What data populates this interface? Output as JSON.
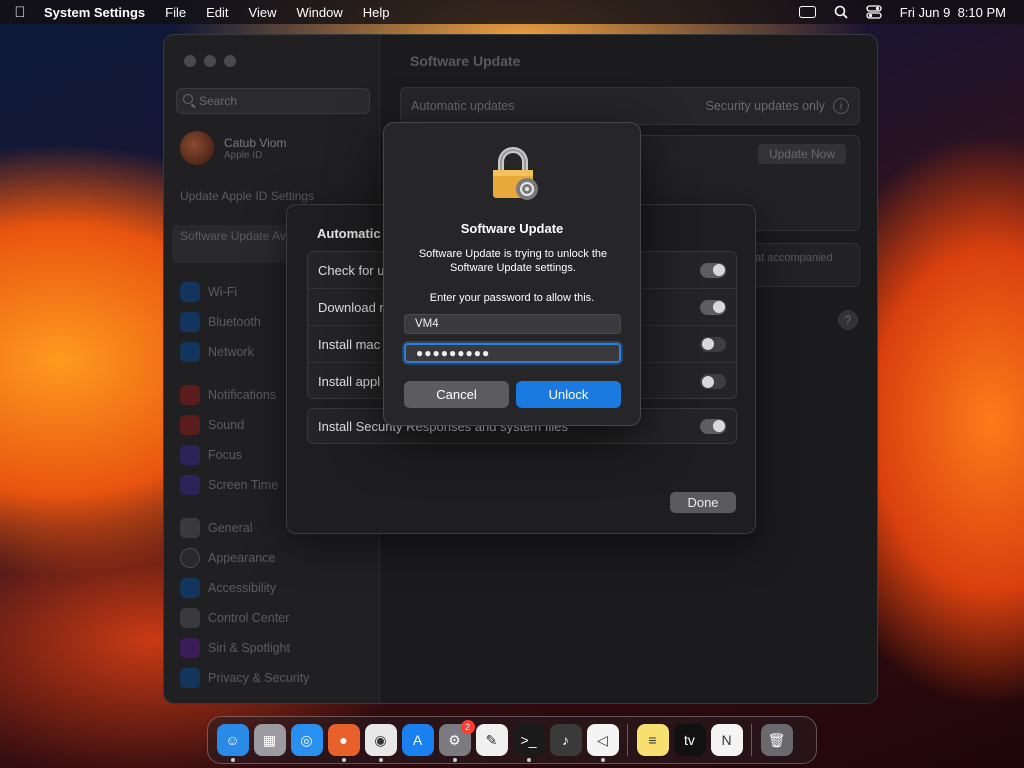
{
  "menubar": {
    "app_name": "System Settings",
    "menus": [
      "File",
      "Edit",
      "View",
      "Window",
      "Help"
    ],
    "datetime": "Fri Jun 9  8:10 PM"
  },
  "sidebar": {
    "search_placeholder": "Search",
    "account_name": "Catub Viom",
    "account_sub": "Apple ID",
    "update_apple_id": "Update Apple ID Settings",
    "software_update": "Software Update Available",
    "items": [
      {
        "label": "Wi-Fi",
        "icon": "wifi-icon",
        "color": "#1a6fd0"
      },
      {
        "label": "Bluetooth",
        "icon": "bluetooth-icon",
        "color": "#1a6fd0"
      },
      {
        "label": "Network",
        "icon": "network-icon",
        "color": "#1a6fd0"
      },
      {
        "label": "Notifications",
        "icon": "notifications-icon",
        "color": "#d83a3a"
      },
      {
        "label": "Sound",
        "icon": "sound-icon",
        "color": "#d83a3a"
      },
      {
        "label": "Focus",
        "icon": "focus-icon",
        "color": "#5a4ad0"
      },
      {
        "label": "Screen Time",
        "icon": "screen-time-icon",
        "color": "#5a4ad0"
      },
      {
        "label": "General",
        "icon": "general-icon",
        "color": "#6a6a6c"
      },
      {
        "label": "Appearance",
        "icon": "appearance-icon",
        "color": "#2a2a2c"
      },
      {
        "label": "Accessibility",
        "icon": "accessibility-icon",
        "color": "#1a6fd0"
      },
      {
        "label": "Control Center",
        "icon": "control-center-icon",
        "color": "#6a6a6c"
      },
      {
        "label": "Siri & Spotlight",
        "icon": "siri-icon",
        "color": "#8a3ad0"
      },
      {
        "label": "Privacy & Security",
        "icon": "privacy-icon",
        "color": "#1a6fd0"
      }
    ]
  },
  "main": {
    "title": "Software Update",
    "auto_updates_label": "Automatic updates",
    "auto_updates_value": "Security updates only",
    "update_now": "Update Now",
    "note_fragment": "at accompanied",
    "help": "?"
  },
  "auto_sheet": {
    "title": "Automatic",
    "options": [
      {
        "label": "Check for u",
        "state": "on"
      },
      {
        "label": "Download n",
        "state": "on"
      },
      {
        "label": "Install mac",
        "state": "off"
      },
      {
        "label": "Install appl",
        "state": "off"
      }
    ],
    "security_label": "Install Security Responses and system files",
    "security_state": "on",
    "done": "Done"
  },
  "dialog": {
    "title": "Software Update",
    "message": "Software Update is trying to unlock the Software Update settings.",
    "prompt": "Enter your password to allow this.",
    "username": "VM4",
    "password_mask": "●●●●●●●●●",
    "cancel": "Cancel",
    "unlock": "Unlock"
  },
  "dock": {
    "apps": [
      {
        "name": "finder-icon",
        "color": "#2a8ae8",
        "glyph": "☺",
        "running": true
      },
      {
        "name": "launchpad-icon",
        "color": "#9a9aa0",
        "glyph": "▦",
        "running": false
      },
      {
        "name": "safari-icon",
        "color": "#2a90f0",
        "glyph": "◎",
        "running": false
      },
      {
        "name": "firefox-icon",
        "color": "#e8602a",
        "glyph": "●",
        "running": true
      },
      {
        "name": "chrome-icon",
        "color": "#e8e8e8",
        "glyph": "◉",
        "running": true
      },
      {
        "name": "app-store-icon",
        "color": "#1a80f0",
        "glyph": "A",
        "running": false
      },
      {
        "name": "system-settings-icon",
        "color": "#7a7a80",
        "glyph": "⚙",
        "running": true,
        "badge": "2"
      },
      {
        "name": "textedit-icon",
        "color": "#f0f0f0",
        "glyph": "✎",
        "running": false
      },
      {
        "name": "terminal-icon",
        "color": "#1a1a1a",
        "glyph": ">_",
        "running": true
      },
      {
        "name": "garageband-icon",
        "color": "#3a3a3a",
        "glyph": "♪",
        "running": false
      },
      {
        "name": "vscode-icon",
        "color": "#f4f4f4",
        "glyph": "◁",
        "running": true
      },
      {
        "name": "notes-icon",
        "color": "#f8e070",
        "glyph": "≡",
        "running": false
      },
      {
        "name": "apple-tv-icon",
        "color": "#111111",
        "glyph": "tv",
        "running": false
      },
      {
        "name": "news-icon",
        "color": "#f4f4f4",
        "glyph": "N",
        "running": false
      },
      {
        "name": "trash-icon",
        "color": "#6a6a6e",
        "glyph": "🗑",
        "running": false
      }
    ]
  }
}
